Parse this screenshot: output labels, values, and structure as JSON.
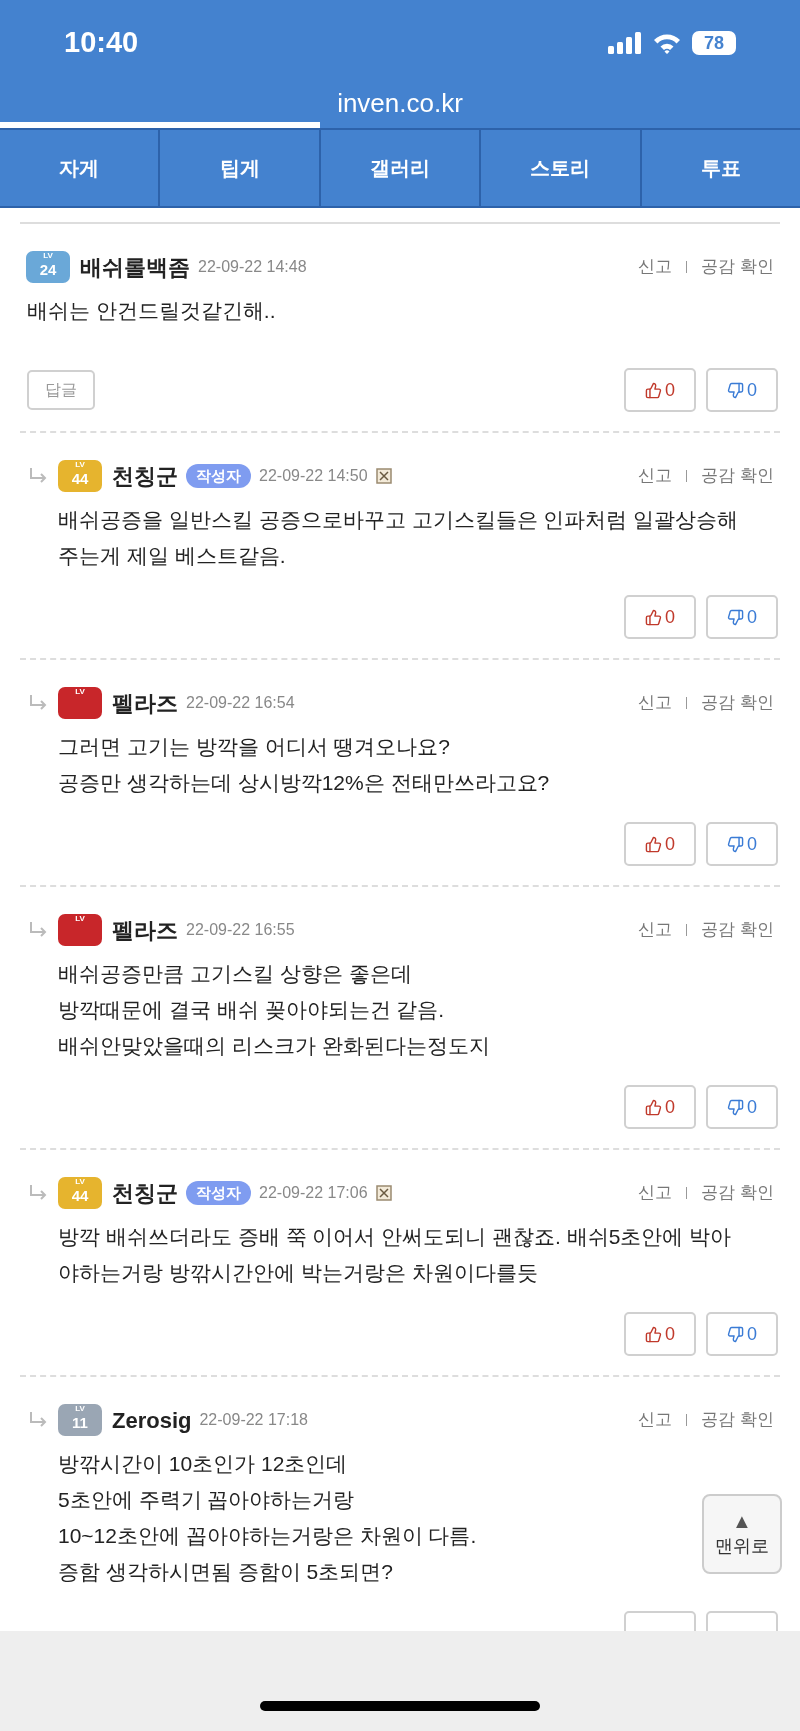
{
  "status_bar": {
    "time": "10:40",
    "battery": "78"
  },
  "url": "inven.co.kr",
  "load_progress": {
    "level": 0.4
  },
  "tabs": [
    {
      "label": "자게"
    },
    {
      "label": "팁게"
    },
    {
      "label": "갤러리"
    },
    {
      "label": "스토리"
    },
    {
      "label": "투표"
    }
  ],
  "comments": [
    {
      "kind": "comment",
      "badge": {
        "label": "LV",
        "number": "24",
        "color": "#6aa8d8"
      },
      "author": "배쉬롤백좀",
      "date": "22-09-22 14:48",
      "report": "신고",
      "empathy": "공감 확인",
      "lines": [
        "배쉬는 안건드릴것같긴해.."
      ],
      "reply_button": "답글",
      "likes": "0",
      "dislikes": "0"
    },
    {
      "kind": "reply",
      "badge": {
        "label": "LV",
        "number": "44",
        "color": "#e6b42e"
      },
      "author": "천칭군",
      "author_tag": "작성자",
      "delete_mark": true,
      "date": "22-09-22 14:50",
      "report": "신고",
      "empathy": "공감 확인",
      "lines": [
        "배쉬공증을 일반스킬 공증으로바꾸고 고기스킬들은 인파처럼 일괄상승해",
        "주는게 제일 베스트같음."
      ],
      "likes": "0",
      "dislikes": "0"
    },
    {
      "kind": "reply",
      "badge": {
        "label": "LV",
        "color": "#c8262a"
      },
      "author": "펠라즈",
      "date": "22-09-22 16:54",
      "report": "신고",
      "empathy": "공감 확인",
      "lines": [
        "그러면 고기는 방깍을 어디서 땡겨오나요?",
        "공증만 생각하는데 상시방깍12%은 전태만쓰라고요?"
      ],
      "likes": "0",
      "dislikes": "0"
    },
    {
      "kind": "reply",
      "badge": {
        "label": "LV",
        "color": "#c8262a"
      },
      "author": "펠라즈",
      "date": "22-09-22 16:55",
      "report": "신고",
      "empathy": "공감 확인",
      "lines": [
        "배쉬공증만큼 고기스킬 상향은 좋은데",
        "방깍때문에 결국 배쉬 꽂아야되는건 같음.",
        "배쉬안맞았을때의 리스크가 완화된다는정도지"
      ],
      "likes": "0",
      "dislikes": "0"
    },
    {
      "kind": "reply",
      "badge": {
        "label": "LV",
        "number": "44",
        "color": "#e6b42e"
      },
      "author": "천칭군",
      "author_tag": "작성자",
      "delete_mark": true,
      "date": "22-09-22 17:06",
      "report": "신고",
      "empathy": "공감 확인",
      "lines": [
        "방깍 배쉬쓰더라도 증배 쭉 이어서 안써도되니 괜찮죠. 배쉬5초안에 박아",
        "야하는거랑 방깎시간안에 박는거랑은 차원이다를듯"
      ],
      "likes": "0",
      "dislikes": "0"
    },
    {
      "kind": "reply",
      "badge": {
        "label": "LV",
        "number": "11",
        "color": "#9aa6b4"
      },
      "author": "Zerosig",
      "date": "22-09-22 17:18",
      "report": "신고",
      "empathy": "공감 확인",
      "lines": [
        "방깎시간이 10초인가 12초인데",
        "5초안에 주력기 꼽아야하는거랑",
        "10~12초안에 꼽아야하는거랑은 차원이 다름.",
        "증함 생각하시면됨 증함이 5초되면?"
      ]
    }
  ],
  "scroll_top": {
    "arrow": "▲",
    "label": "맨위로"
  }
}
